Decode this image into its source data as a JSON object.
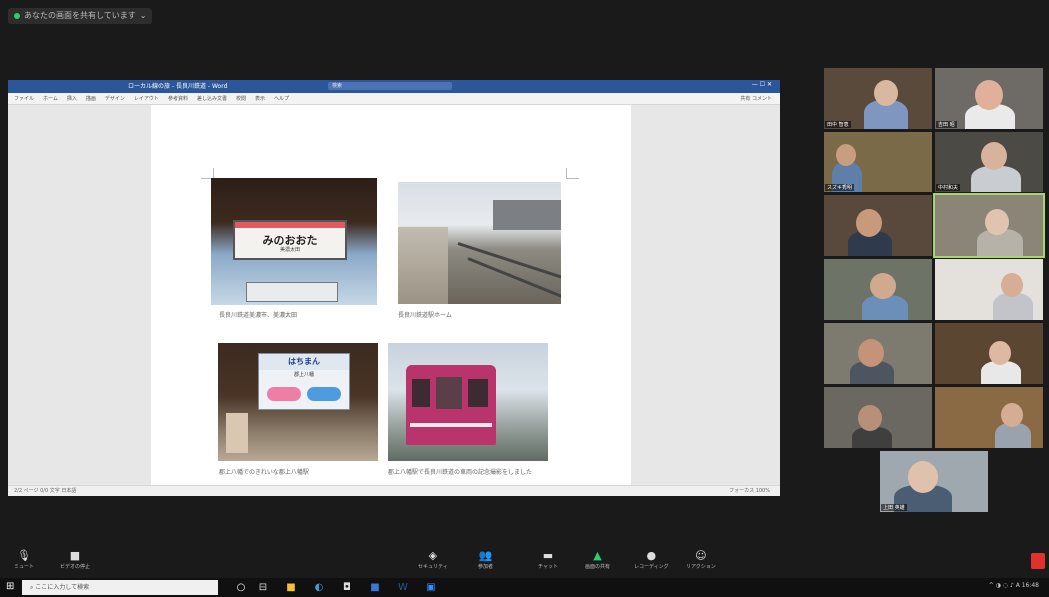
{
  "top": {
    "share_label": "あなたの画面を共有しています"
  },
  "word": {
    "title": "ローカル線の旅 - 長良川鉄道 - Word",
    "search_placeholder": "検索",
    "window_buttons": "—  ☐  ✕",
    "ribbon_tabs": [
      "ファイル",
      "ホーム",
      "挿入",
      "描画",
      "デザイン",
      "レイアウト",
      "参考資料",
      "差し込み文書",
      "校閲",
      "表示",
      "ヘルプ"
    ],
    "ribbon_right": "共有  コメント",
    "status_left": "2/2 ページ  0/0 文字  日本語",
    "status_right": "フォーカス  100%",
    "captions": [
      "長良川鉄道美濃市、美濃太田",
      "長良川鉄道駅ホーム",
      "郡上八幡でのきれいな郡上八幡駅",
      "郡上八幡駅で長良川鉄道の車両の記念撮影をしました"
    ],
    "sign1_main": "みのおおた",
    "sign1_sub": "美濃太田",
    "sign3_main": "はちまん",
    "sign3_sub": "郡上八幡"
  },
  "participants": [
    "田中 智恵",
    "吉田 昭",
    "スズキ秀明",
    "中村和夫",
    "",
    "",
    "",
    "",
    "",
    "",
    "",
    "",
    "上田 英雄"
  ],
  "toolbar": {
    "mute": "ミュート",
    "video": "ビデオの停止",
    "security": "セキュリティ",
    "participants": "参加者",
    "chat": "チャット",
    "share": "画面の共有",
    "record": "レコーディング",
    "reactions": "リアクション"
  },
  "taskbar": {
    "search": "ここに入力して検索",
    "tray_time": "16:48"
  },
  "colors": {
    "word_blue": "#2b579a",
    "zoom_green": "#2ecc71",
    "end_red": "#e0312f",
    "active_speaker": "#a5d86b"
  }
}
